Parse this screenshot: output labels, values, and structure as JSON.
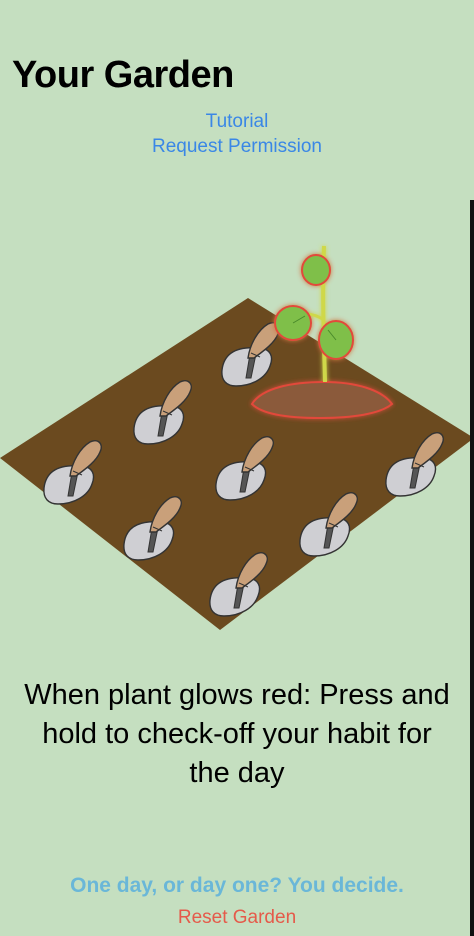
{
  "header": {
    "title": "Your Garden"
  },
  "links": {
    "tutorial": "Tutorial",
    "request_permission": "Request Permission"
  },
  "garden": {
    "plot_icon": "trowel-icon",
    "plant_icon": "sprout-icon",
    "plant_state": "glowing-red"
  },
  "instructions": "When plant glows red: Press and hold to check-off your habit for the day",
  "footer": {
    "motto": "One day, or day one? You decide.",
    "reset_label": "Reset Garden"
  },
  "colors": {
    "background": "#c5dfc0",
    "soil": "#6b4a1f",
    "link": "#3a87e6",
    "motto": "#6ab7d8",
    "reset": "#e55a4a",
    "glow": "#e2483a"
  }
}
